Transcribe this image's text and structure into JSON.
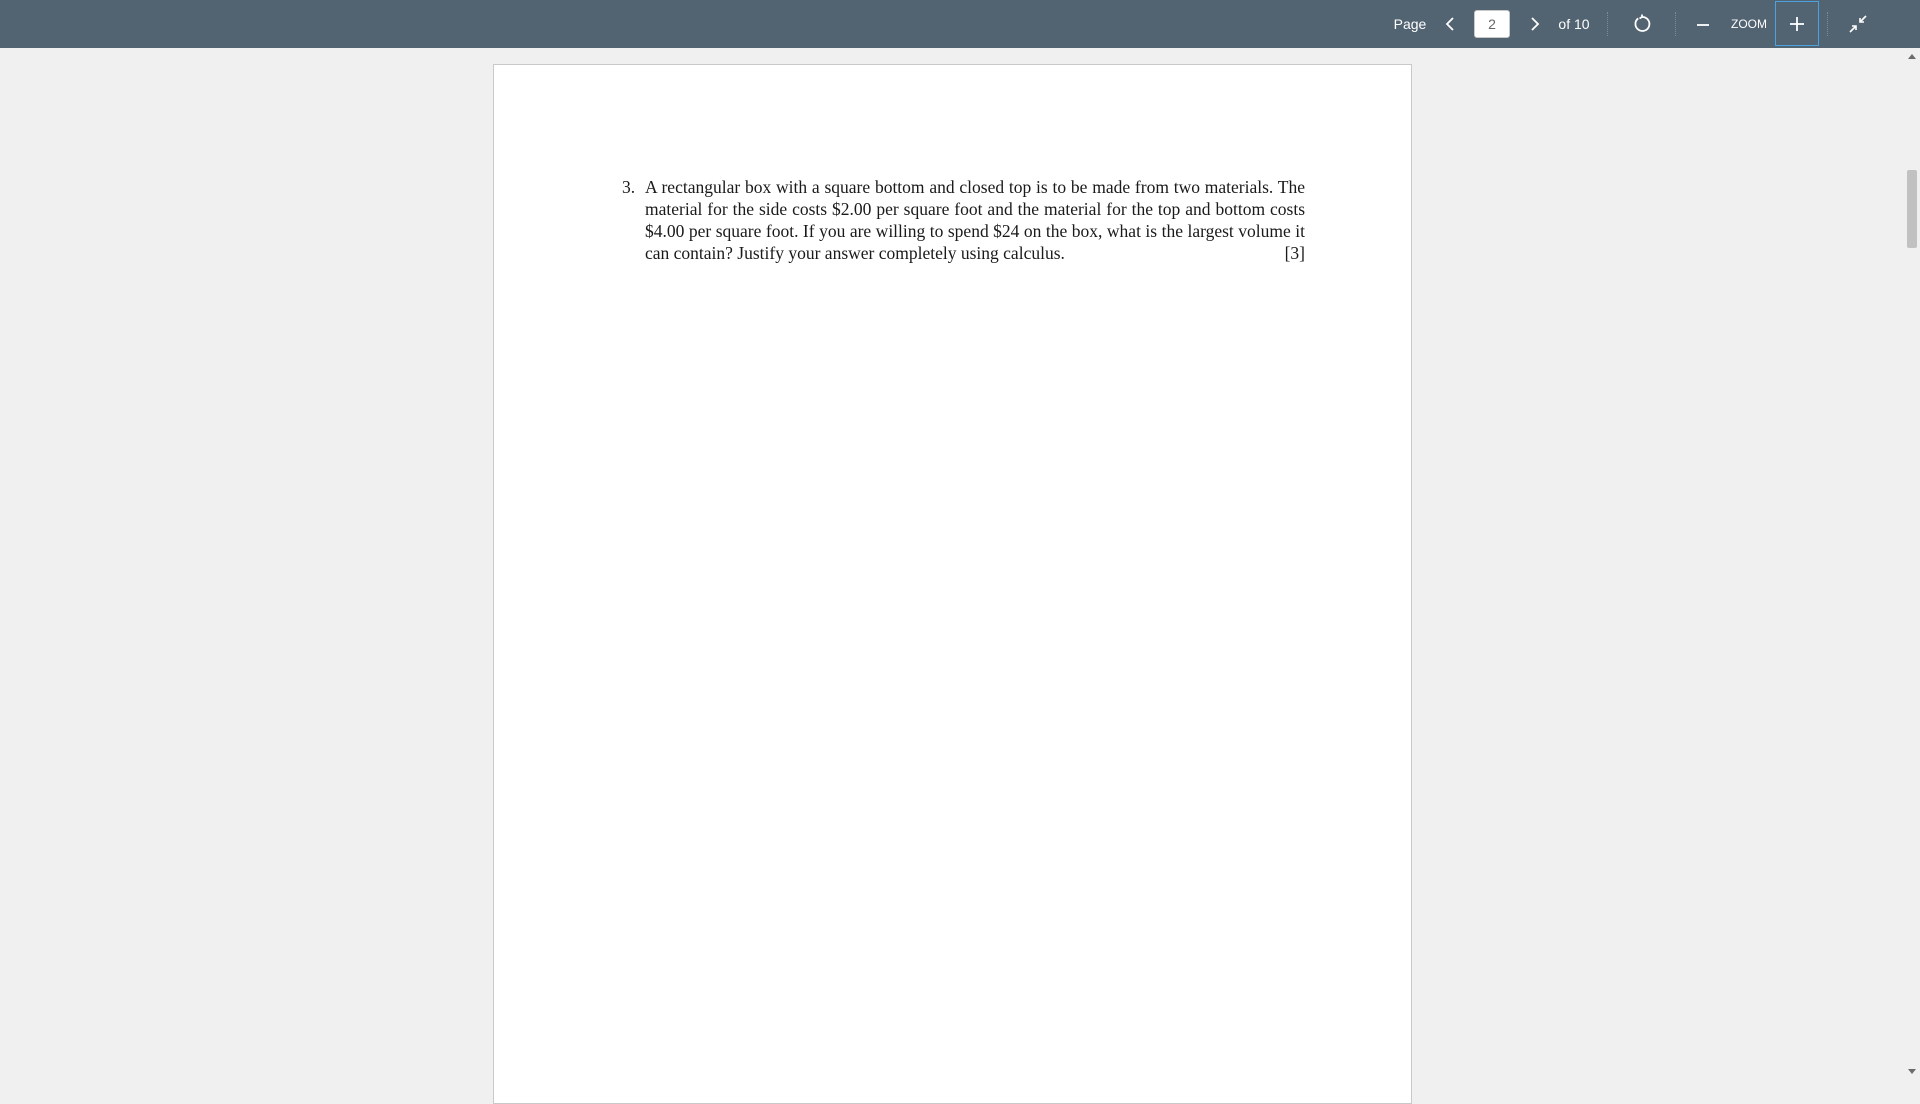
{
  "toolbar": {
    "page_label": "Page",
    "current_page": "2",
    "total_pages": "of 10",
    "zoom_label": "ZOOM",
    "background_color": "#526372",
    "icons": {
      "prev": "chevron-left-icon",
      "next": "chevron-right-icon",
      "rotate": "rotate-icon",
      "zoom_out": "minus-icon",
      "zoom_in": "plus-icon",
      "exit_fullscreen": "collapse-icon"
    }
  },
  "document": {
    "question_number": "3.",
    "question_text": "A rectangular box with a square bottom and closed top is to be made from two materials. The material for the side costs $2.00 per square foot and the material for the top and bottom costs $4.00 per square foot. If you are willing to spend $24 on the box, what is the largest volume it can contain? Justify your answer completely using calculus.",
    "question_marks": "[3]"
  }
}
